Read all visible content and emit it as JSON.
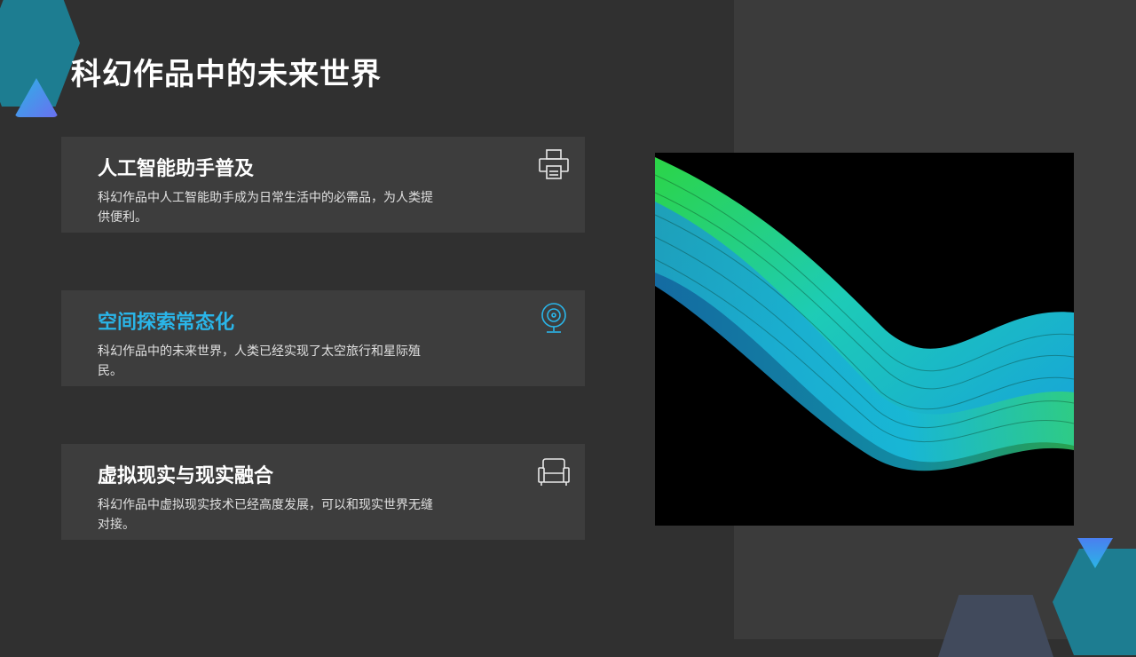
{
  "slide": {
    "title": "科幻作品中的未来世界",
    "cards": [
      {
        "title": "人工智能助手普及",
        "description": "科幻作品中人工智能助手成为日常生活中的必需品，为人类提供便利。",
        "icon": "printer-icon"
      },
      {
        "title": "空间探索常态化",
        "description": "科幻作品中的未来世界，人类已经实现了太空旅行和星际殖民。",
        "icon": "webcam-icon"
      },
      {
        "title": "虚拟现实与现实融合",
        "description": "科幻作品中虚拟现实技术已经高度发展，可以和现实世界无缝对接。",
        "icon": "sofa-icon"
      }
    ]
  },
  "colors": {
    "background": "#303030",
    "panel": "#3b3b3b",
    "card": "#3d3d3d",
    "accent": "#2ab5e8",
    "teal": "#1d7d91"
  }
}
